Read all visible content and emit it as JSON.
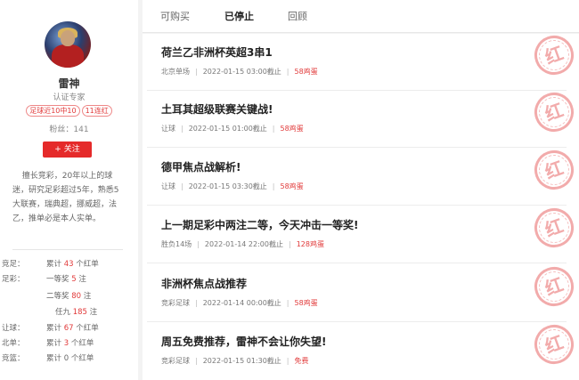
{
  "profile": {
    "name": "雷神",
    "role": "认证专家",
    "tags": [
      "足球近10中10",
      "11连红"
    ],
    "fans": "粉丝：141",
    "follow_label": "+ 关注",
    "bio": "擅长竞彩，20年以上的球迷，研究足彩超过5年，熟悉5大联赛，瑞典超，挪威超，法乙，推单必是本人实单。"
  },
  "stats": [
    {
      "label": "竞足：",
      "prefix": "累计",
      "num": "43",
      "suffix": "个红单"
    },
    {
      "label": "足彩：",
      "prefix": "一等奖",
      "num": "5",
      "suffix": "注"
    },
    {
      "label": "",
      "prefix": "二等奖",
      "num": "80",
      "suffix": "注"
    },
    {
      "label": "",
      "prefix": "任九",
      "num": "185",
      "suffix": "注"
    },
    {
      "label": "让球：",
      "prefix": "累计",
      "num": "67",
      "suffix": "个红单"
    },
    {
      "label": "北单：",
      "prefix": "累计",
      "num": "3",
      "suffix": "个红单"
    },
    {
      "label": "竞篮：",
      "prefix": "累计",
      "num": "0",
      "suffix": "个红单"
    }
  ],
  "tabs": [
    "可购买",
    "已停止",
    "回顾"
  ],
  "active_tab": 1,
  "stamp_text": "红",
  "items": [
    {
      "title": "荷兰乙非洲杯英超3串1",
      "type": "北京单场",
      "time": "2022-01-15 03:00截止",
      "price": "58鸡蛋"
    },
    {
      "title": "土耳其超级联赛关键战!",
      "type": "让球",
      "time": "2022-01-15 01:00截止",
      "price": "58鸡蛋"
    },
    {
      "title": "德甲焦点战解析!",
      "type": "让球",
      "time": "2022-01-15 03:30截止",
      "price": "58鸡蛋"
    },
    {
      "title": "上一期足彩中两注二等，今天冲击一等奖!",
      "type": "胜负14场",
      "time": "2022-01-14 22:00截止",
      "price": "128鸡蛋"
    },
    {
      "title": "非洲杯焦点战推荐",
      "type": "竞彩足球",
      "time": "2022-01-14 00:00截止",
      "price": "58鸡蛋"
    },
    {
      "title": "周五免费推荐，雷神不会让你失望!",
      "type": "竞彩足球",
      "time": "2022-01-15 01:30截止",
      "price": "免费"
    }
  ]
}
